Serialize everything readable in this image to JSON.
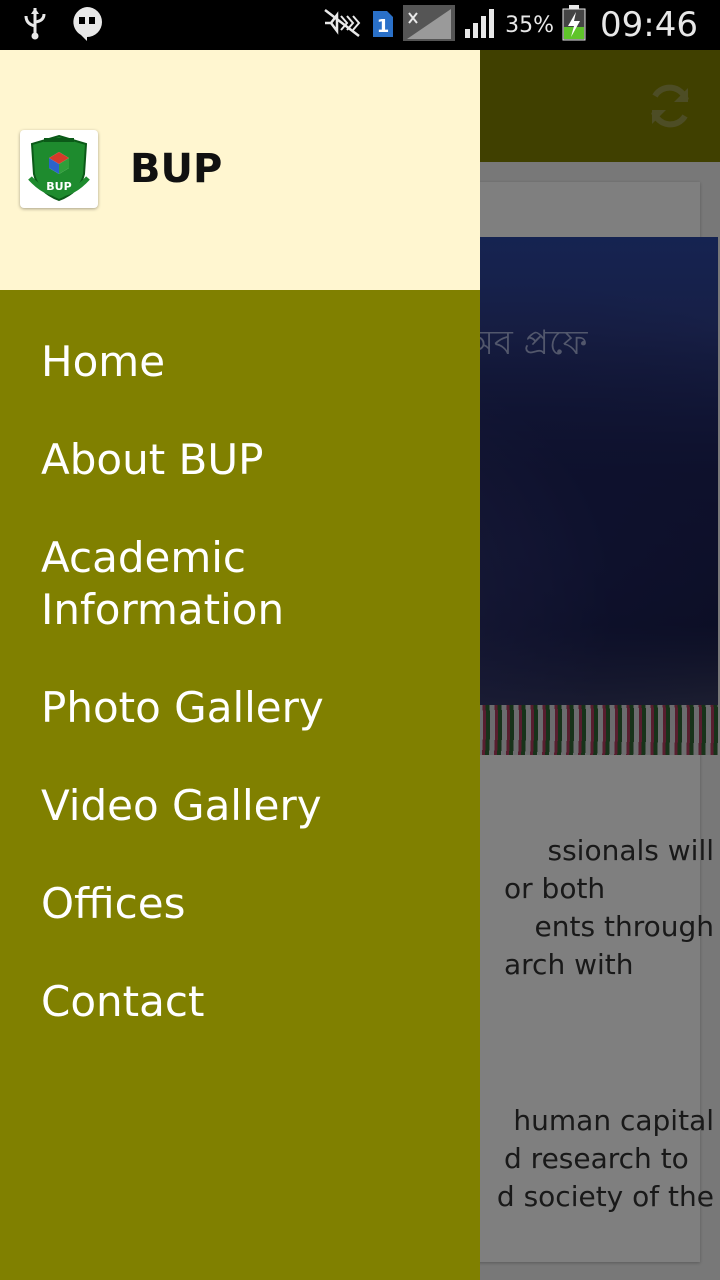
{
  "status_bar": {
    "battery_percent": "35%",
    "time": "09:46",
    "sim_badge": "1",
    "icons": [
      "usb-icon",
      "hangouts-icon",
      "mute-icon",
      "sim-icon",
      "signal-icon",
      "signal-icon",
      "battery-charging-icon"
    ]
  },
  "drawer": {
    "app_name": "BUP",
    "logo_icon": "bup-logo-icon",
    "logo_text": "BUP",
    "menu": [
      {
        "label": "Home"
      },
      {
        "label": "About BUP"
      },
      {
        "label": "Academic Information"
      },
      {
        "label": "Photo Gallery"
      },
      {
        "label": "Video Gallery"
      },
      {
        "label": "Offices"
      },
      {
        "label": "Contact"
      }
    ]
  },
  "background": {
    "toolbar_icon": "refresh-icon",
    "paragraph1": [
      "ssionals will",
      "or both",
      "ents through",
      "arch with"
    ],
    "paragraph2": [
      "human capital",
      "d research to",
      "d society of the"
    ]
  },
  "colors": {
    "drawer_bg": "#808000",
    "header_bg": "#fff6d0",
    "toolbar_bg": "#808000"
  }
}
